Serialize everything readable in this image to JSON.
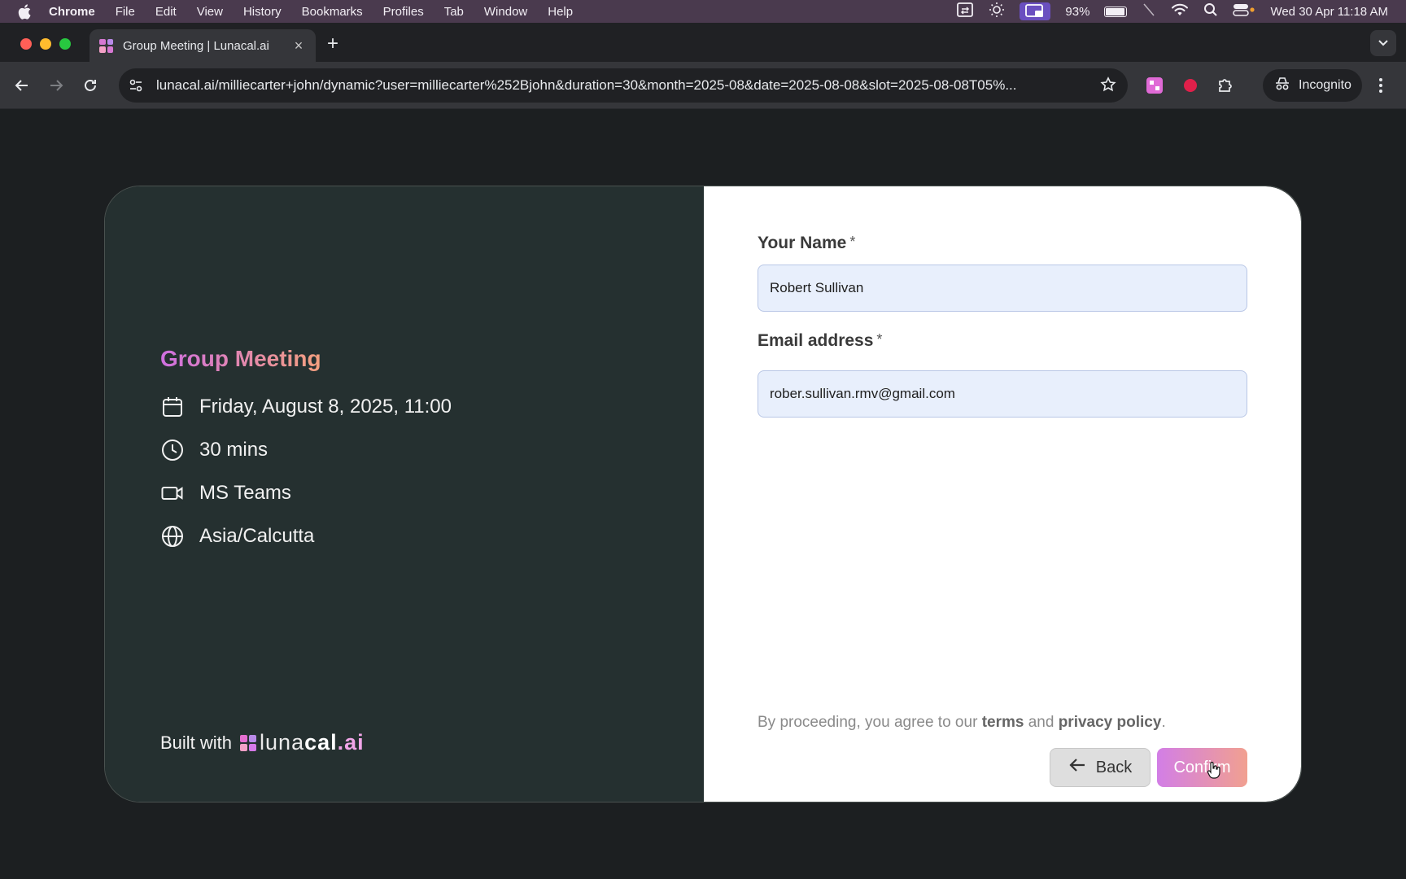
{
  "menubar": {
    "app_name": "Chrome",
    "items": [
      "File",
      "Edit",
      "View",
      "History",
      "Bookmarks",
      "Profiles",
      "Tab",
      "Window",
      "Help"
    ],
    "battery": "93%",
    "datetime": "Wed 30 Apr  11:18 AM"
  },
  "browser": {
    "tab_title": "Group Meeting | Lunacal.ai",
    "url": "lunacal.ai/milliecarter+john/dynamic?user=milliecarter%252Bjohn&duration=30&month=2025-08&date=2025-08-08&slot=2025-08-08T05%...",
    "incognito_label": "Incognito"
  },
  "event": {
    "title": "Group Meeting",
    "datetime": "Friday, August 8, 2025, 11:00",
    "duration": "30 mins",
    "location": "MS Teams",
    "timezone": "Asia/Calcutta"
  },
  "branding": {
    "built_with": "Built with",
    "logo_light": "luna",
    "logo_bold": "cal",
    "logo_ai": ".ai",
    "logo_colors": [
      "#e46fd0",
      "#b98ae8",
      "#f3a0c6",
      "#d679e9"
    ]
  },
  "form": {
    "name_label": "Your Name",
    "name_required": "*",
    "name_value": "Robert Sullivan",
    "email_label": "Email address",
    "email_required": "*",
    "email_value": "rober.sullivan.rmv@gmail.com",
    "terms_prefix": "By proceeding, you agree to our ",
    "terms_link": "terms",
    "terms_and": " and ",
    "privacy_link": "privacy policy",
    "terms_suffix": ".",
    "back_label": "Back",
    "confirm_label": "Confirm"
  },
  "colors": {
    "left_panel": "#253030",
    "accent_gradient_start": "#cf6fe0",
    "accent_gradient_end": "#f5a07e"
  }
}
